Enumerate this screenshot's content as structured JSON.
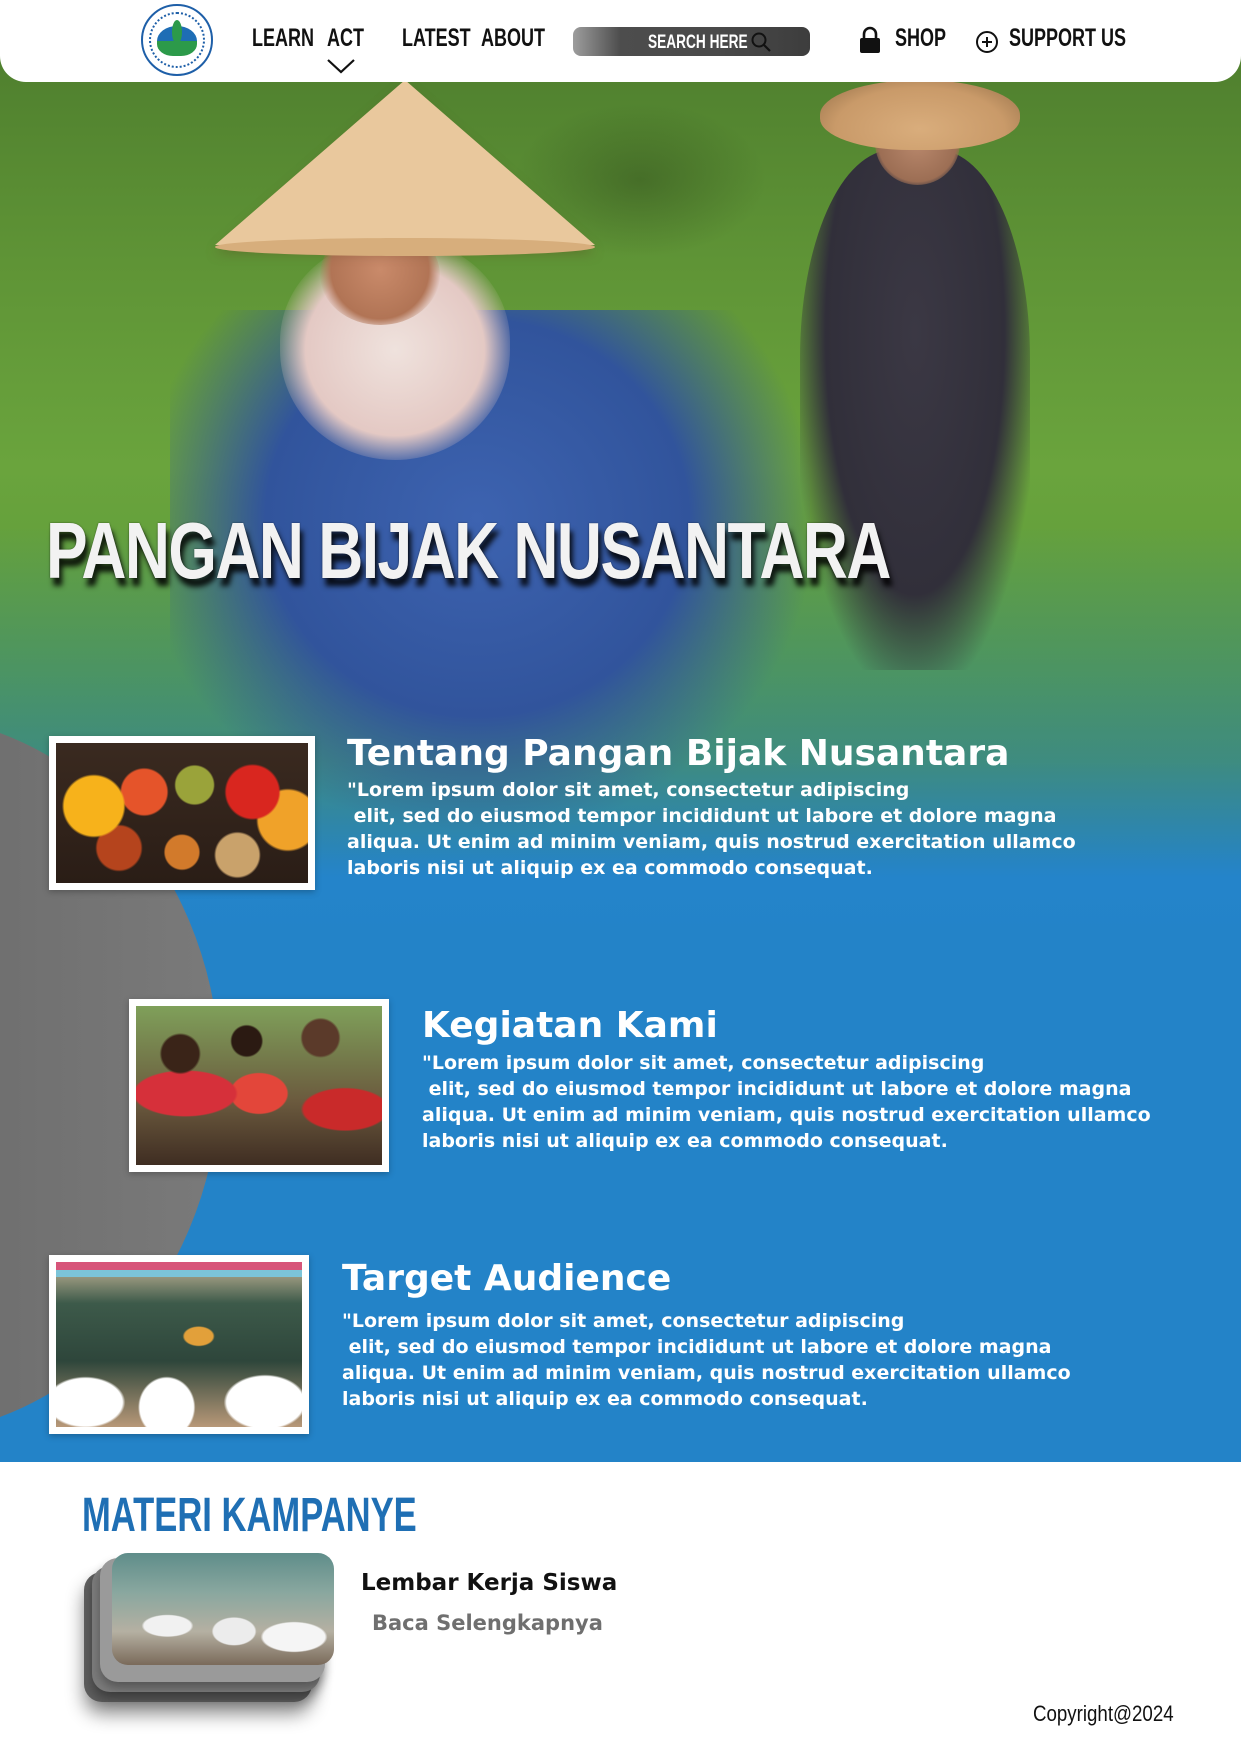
{
  "nav": {
    "logo_text": "SEKOLAH MENENGAH KEJURUAN DEWANTARA",
    "items": {
      "learn": "LEARN",
      "act": "ACT",
      "latest": "LATEST",
      "about": "ABOUT"
    },
    "search_placeholder": "SEARCH HERE",
    "shop": "SHOP",
    "support": "SUPPORT US"
  },
  "hero": {
    "title": "PANGAN BIJAK NUSANTARA"
  },
  "sections": [
    {
      "title": "Tentang Pangan Bijak Nusantara",
      "body": "\"Lorem ipsum dolor sit amet, consectetur adipiscing\n elit, sed do eiusmod tempor incididunt ut labore et dolore magna\naliqua. Ut enim ad minim veniam, quis nostrud exercitation ullamco\nlaboris nisi ut aliquip ex ea commodo consequat."
    },
    {
      "title": "Kegiatan Kami",
      "body": "\"Lorem ipsum dolor sit amet, consectetur adipiscing\n elit, sed do eiusmod tempor incididunt ut labore et dolore magna\naliqua. Ut enim ad minim veniam, quis nostrud exercitation ullamco\nlaboris nisi ut aliquip ex ea commodo consequat."
    },
    {
      "title": "Target Audience",
      "body": "\"Lorem ipsum dolor sit amet, consectetur adipiscing\n elit, sed do eiusmod tempor incididunt ut labore et dolore magna\naliqua. Ut enim ad minim veniam, quis nostrud exercitation ullamco\nlaboris nisi ut aliquip ex ea commodo consequat."
    }
  ],
  "materi": {
    "heading": "MATERI KAMPANYE",
    "item_title": "Lembar Kerja Siswa",
    "item_link": "Baca Selengkapnya"
  },
  "footer": {
    "copyright": "Copyright@2024"
  },
  "colors": {
    "primary_blue": "#2383c8",
    "heading_blue": "#1f6fb4",
    "grey_accent": "#6e6e6e"
  }
}
